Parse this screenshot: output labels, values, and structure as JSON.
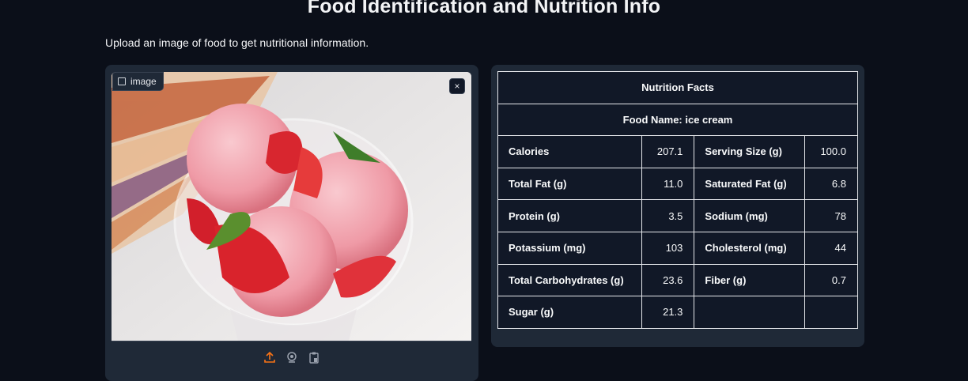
{
  "page": {
    "title": "Food Identification and Nutrition Info",
    "subtitle": "Upload an image of food to get nutritional information."
  },
  "image_input": {
    "label": "image",
    "clear_symbol": "×",
    "toolbar_icons": [
      "upload-icon",
      "webcam-icon",
      "clipboard-icon"
    ],
    "accent_color": "#f97316"
  },
  "nutrition": {
    "header": "Nutrition Facts",
    "food_name": "Food Name: ice cream",
    "rows": [
      {
        "l1": "Calories",
        "v1": "207.1",
        "l2": "Serving Size (g)",
        "v2": "100.0"
      },
      {
        "l1": "Total Fat (g)",
        "v1": "11.0",
        "l2": "Saturated Fat (g)",
        "v2": "6.8"
      },
      {
        "l1": "Protein (g)",
        "v1": "3.5",
        "l2": "Sodium (mg)",
        "v2": "78"
      },
      {
        "l1": "Potassium (mg)",
        "v1": "103",
        "l2": "Cholesterol (mg)",
        "v2": "44"
      },
      {
        "l1": "Total Carbohydrates (g)",
        "v1": "23.6",
        "l2": "Fiber (g)",
        "v2": "0.7"
      },
      {
        "l1": "Sugar (g)",
        "v1": "21.3",
        "l2": "",
        "v2": ""
      }
    ]
  }
}
